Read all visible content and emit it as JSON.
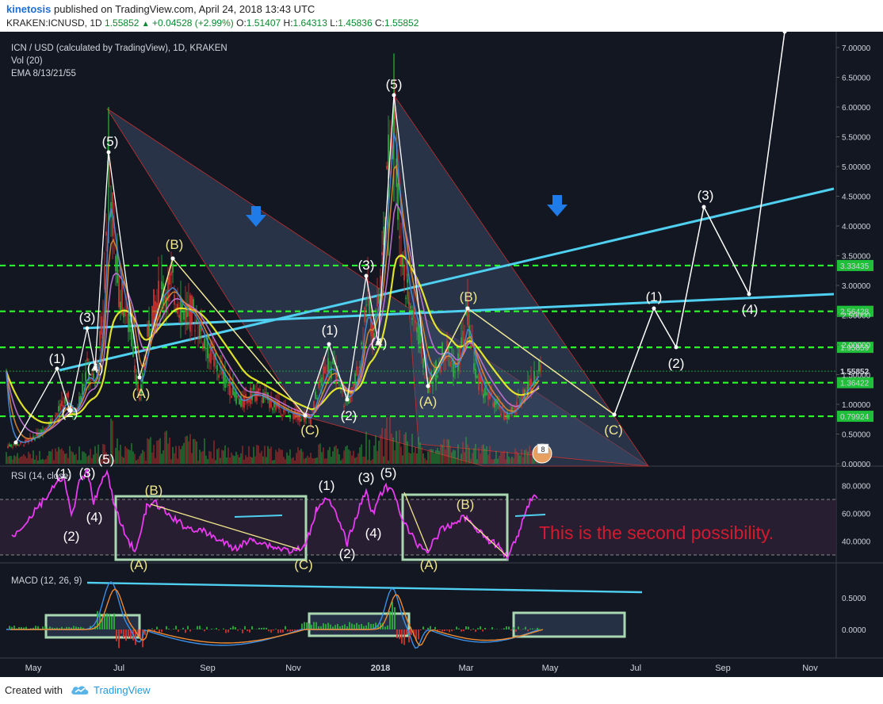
{
  "header": {
    "author": "kinetosis",
    "published": "published on TradingView.com, April 24, 2018 13:43 UTC",
    "symbol": "KRAKEN:ICNUSD, 1D",
    "last": "1.55852",
    "up_arrow": "▲",
    "change": "+0.04528 (+2.99%)",
    "o_label": "O:",
    "o": "1.51407",
    "h_label": "H:",
    "h": "1.64313",
    "l_label": "L:",
    "l": "1.45836",
    "c_label": "C:",
    "c": "1.55852"
  },
  "footer": {
    "created": "Created with",
    "brand": "TradingView",
    "logo_icon": "tradingview-cloud-icon"
  },
  "colors": {
    "background": "#131722",
    "bull": "#2db83d",
    "bear": "#e0342f",
    "level_line": "#2bff2b",
    "trend_line": "#4fd0f0",
    "wave_white": "#ffffff",
    "wave_yellow": "#f0e68c",
    "ema_yellow": "#f5f52a",
    "rsi_line": "#e83bf0",
    "box": "#a9d7b2",
    "annotation": "#d41a2e",
    "arrow": "#1e7be8"
  },
  "chart_data": [
    {
      "type": "candlestick",
      "title": "ICN / USD (calculated by TradingView), 1D, KRAKEN",
      "indicators": [
        "Vol (20)",
        "EMA 8/13/21/55"
      ],
      "x_ticks": [
        "May",
        "Jul",
        "Sep",
        "Nov",
        "2018",
        "Mar",
        "May",
        "Jul",
        "Sep",
        "Nov"
      ],
      "y_ticks": [
        "7.00000",
        "6.50000",
        "6.00000",
        "5.50000",
        "5.00000",
        "4.50000",
        "4.00000",
        "3.50000",
        "3.00000",
        "2.50000",
        "2.00000",
        "1.50000",
        "1.00000",
        "0.50000",
        "0.00000"
      ],
      "ylim": [
        0,
        7.3
      ],
      "last_price_tag": "1.55852",
      "horizontal_levels": [
        {
          "value": 3.33435,
          "label": "3.33435"
        },
        {
          "value": 2.56428,
          "label": "2.56428"
        },
        {
          "value": 1.95859,
          "label": "1.95859"
        },
        {
          "value": 1.36422,
          "label": "1.36422"
        },
        {
          "value": 0.79924,
          "label": "0.79924"
        }
      ],
      "trend_lines": [
        {
          "from": [
            "May 2017",
            1.6
          ],
          "to": [
            "Nov 2018",
            4.65
          ]
        },
        {
          "from": [
            "Jun 2017",
            2.2
          ],
          "to": [
            "Nov 2018",
            2.85
          ]
        }
      ],
      "elliott_labels": {
        "first_cycle": [
          "(1)",
          "(2)",
          "(3)",
          "(4)",
          "(5)",
          "(A)",
          "(B)",
          "(C)"
        ],
        "second_cycle": [
          "(1)",
          "(2)",
          "(3)",
          "(4)",
          "(5)",
          "(A)",
          "(B)",
          "(C)"
        ],
        "projection": [
          "(1)",
          "(2)",
          "(3)",
          "(4)"
        ]
      },
      "projection_path": [
        {
          "x": "Jun 2018",
          "y": 0.8
        },
        {
          "x": "Jul 2018",
          "y": 2.6
        },
        {
          "x": "Aug 2018",
          "y": 1.97
        },
        {
          "x": "Aug 2018",
          "y": 4.35
        },
        {
          "x": "Sep 2018",
          "y": 2.88
        },
        {
          "x": "Oct 2018",
          "y": 7.3
        }
      ],
      "badge": "8"
    },
    {
      "type": "line",
      "title": "RSI (14, close)",
      "y_ticks": [
        "80.0000",
        "60.0000",
        "40.0000"
      ],
      "ylim": [
        20,
        95
      ],
      "bands": [
        70,
        30
      ],
      "annotation": "This is the second possibility.",
      "labels": [
        "(1)",
        "(2)",
        "(3)",
        "(4)",
        "(5)",
        "(B)",
        "(A)",
        "(C)",
        "(1)",
        "(2)",
        "(3)",
        "(4)",
        "(5)",
        "(A)",
        "(B)"
      ]
    },
    {
      "type": "histogram",
      "title": "MACD (12, 26, 9)",
      "y_ticks": [
        "0.5000",
        "0.0000"
      ],
      "ylim": [
        -0.45,
        0.85
      ]
    }
  ]
}
